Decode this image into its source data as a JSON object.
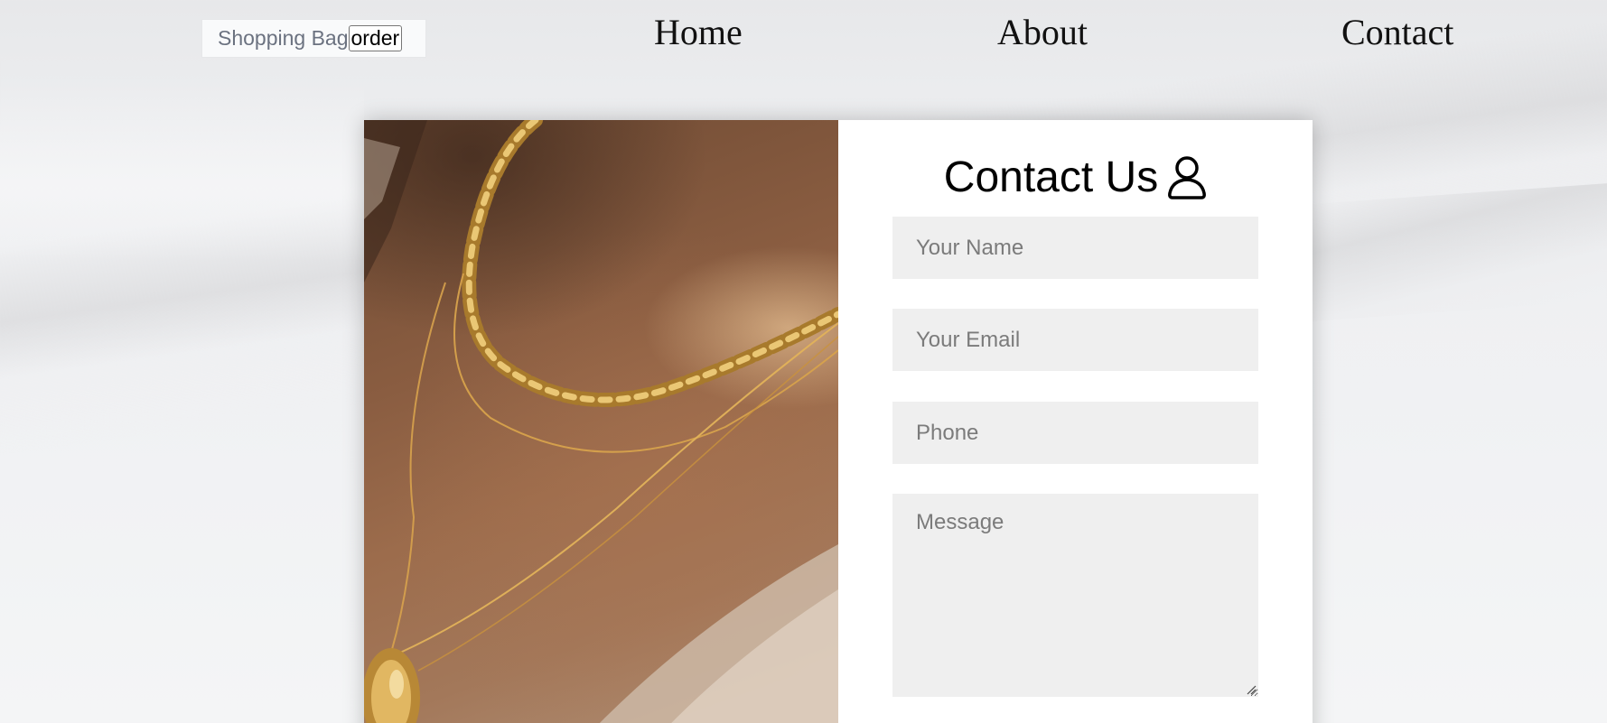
{
  "header": {
    "bag_label": "Shopping Bag",
    "order_button": "order",
    "nav": [
      {
        "label": "Home"
      },
      {
        "label": "About"
      },
      {
        "label": "Contact"
      }
    ]
  },
  "contact": {
    "title": "Contact Us",
    "icon": "user-icon",
    "fields": {
      "name_placeholder": "Your Name",
      "email_placeholder": "Your Email",
      "phone_placeholder": "Phone",
      "message_placeholder": "Message"
    }
  },
  "image": {
    "subject": "gold-necklaces-photo"
  }
}
